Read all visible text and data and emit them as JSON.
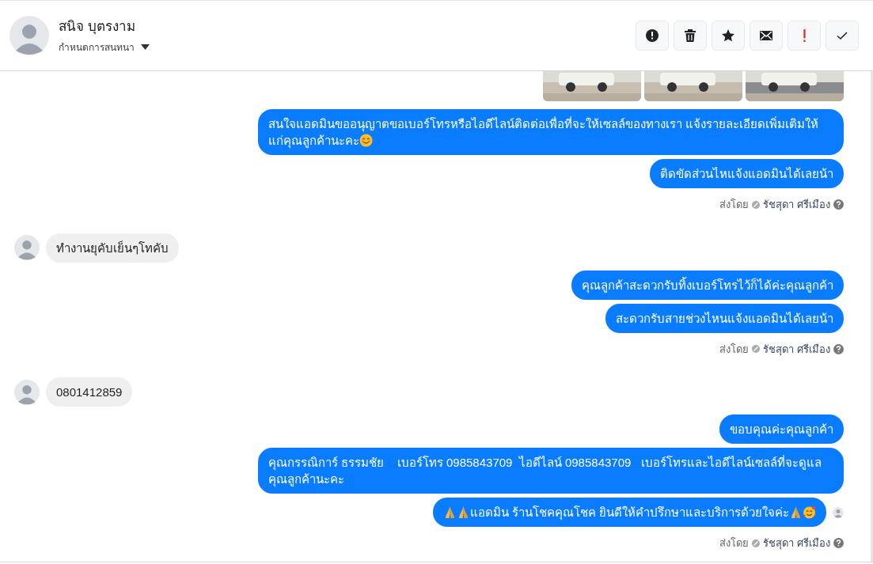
{
  "contact": {
    "name": "สนิจ บุตรงาม",
    "subtitle": "กำหนดการสนทนา"
  },
  "toolbar": [
    {
      "kind": "alert"
    },
    {
      "kind": "trash"
    },
    {
      "kind": "star"
    },
    {
      "kind": "mail"
    },
    {
      "kind": "important"
    },
    {
      "kind": "done"
    }
  ],
  "thread": [
    {
      "kind": "photos"
    },
    {
      "kind": "outgoing",
      "bubbles": [
        {
          "parts": [
            {
              "kind": "text",
              "text": "สนใจแอดมินขออนุญาตขอเบอร์โทรหรือไอดีไลน์ติดต่อเพื่อที่จะให้เซลล์ของทางเรา แจ้งรายละเอียดเพิ่มเติมให้แก่คุณลูกค้านะคะ"
            },
            {
              "kind": "smile"
            }
          ]
        },
        {
          "parts": [
            {
              "kind": "text",
              "text": "ติดขัดส่วนไหแจ้งแอดมินได้เลยน้า"
            }
          ]
        }
      ],
      "sent_by": {
        "label": "ส่งโดย",
        "agent": "รัชสุดา ศรีเมือง"
      },
      "seen": false
    },
    {
      "kind": "incoming",
      "bubbles": [
        {
          "parts": [
            {
              "kind": "text",
              "text": "ทำงานยุคับเย็นๆโทคับ"
            }
          ]
        }
      ]
    },
    {
      "kind": "outgoing",
      "bubbles": [
        {
          "parts": [
            {
              "kind": "text",
              "text": "คุณลูกค้าสะดวกรับทิ้งเบอร์โทรไว้ก็ได้ค่ะคุณลูกค้า"
            }
          ]
        },
        {
          "parts": [
            {
              "kind": "text",
              "text": "สะดวกรับสายช่วงไหนแจ้งแอดมินได้เลยน้า"
            }
          ]
        }
      ],
      "sent_by": {
        "label": "ส่งโดย",
        "agent": "รัชสุดา ศรีเมือง"
      },
      "seen": false
    },
    {
      "kind": "incoming",
      "bubbles": [
        {
          "parts": [
            {
              "kind": "text",
              "text": "0801412859"
            }
          ]
        }
      ]
    },
    {
      "kind": "outgoing",
      "bubbles": [
        {
          "parts": [
            {
              "kind": "text",
              "text": "ขอบคุณค่ะคุณลูกค้า"
            }
          ]
        },
        {
          "parts": [
            {
              "kind": "text",
              "text": "คุณกรรณิการ์ ธรรมชัย    เบอร์โทร 0985843709  ไอดีไลน์ 0985843709   เบอร์โทรและไอดีไลน์เซลล์ที่จะดูแลคุณลูกค้านะคะ"
            }
          ]
        },
        {
          "parts": [
            {
              "kind": "pray"
            },
            {
              "kind": "pray"
            },
            {
              "kind": "text",
              "text": "แอดมิน ร้านโชคคุณโชค ยินดีให้คำปรึกษาและบริการด้วยใจค่ะ"
            },
            {
              "kind": "pray"
            },
            {
              "kind": "love"
            }
          ]
        }
      ],
      "sent_by": {
        "label": "ส่งโดย",
        "agent": "รัชสุดา ศรีเมือง"
      },
      "seen": true
    }
  ]
}
